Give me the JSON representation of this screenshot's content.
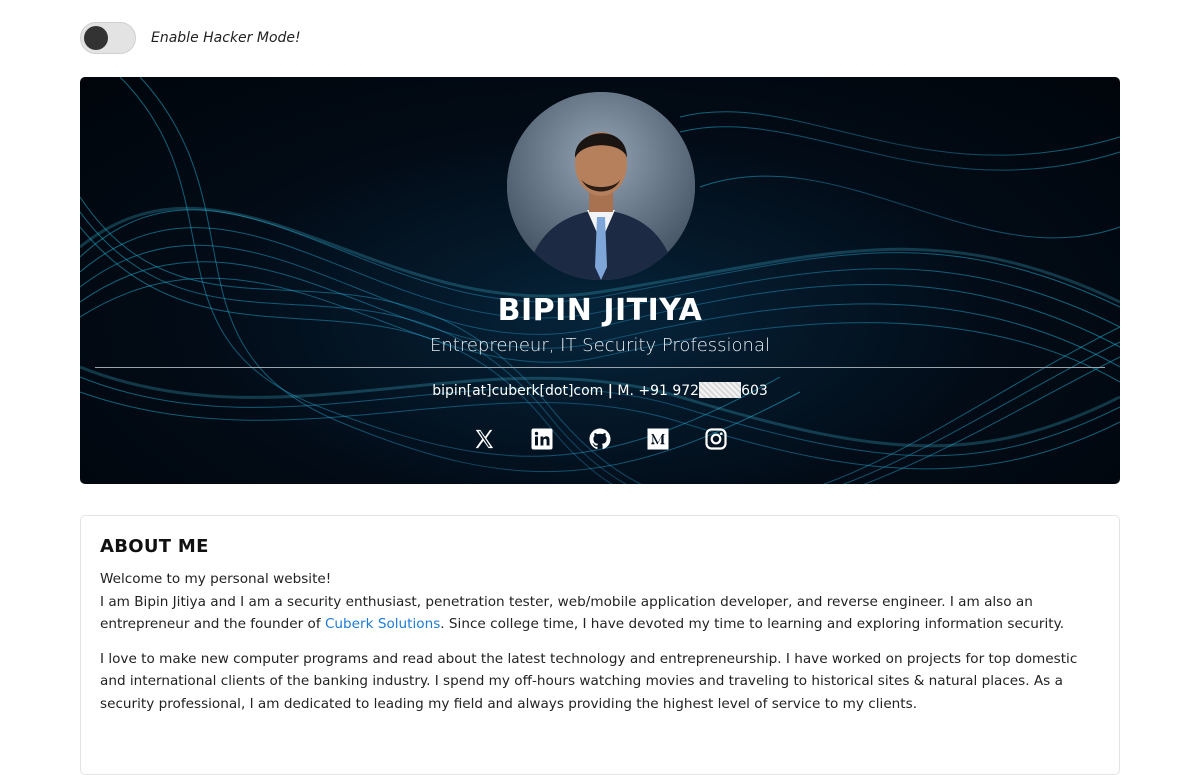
{
  "toggle": {
    "label": "Enable Hacker Mode!",
    "state": "off"
  },
  "profile": {
    "name": "BIPIN JITIYA",
    "subtitle": "Entrepreneur, IT Security Professional",
    "contact_email": "bipin[at]cuberk[dot]com",
    "contact_separator": "|",
    "contact_phone_prefix": "M. +91 972",
    "contact_phone_suffix": "603"
  },
  "socials": [
    {
      "name": "x",
      "icon": "x-icon"
    },
    {
      "name": "linkedin",
      "icon": "linkedin-icon"
    },
    {
      "name": "github",
      "icon": "github-icon"
    },
    {
      "name": "medium",
      "icon": "medium-icon"
    },
    {
      "name": "instagram",
      "icon": "instagram-icon"
    }
  ],
  "about": {
    "heading": "ABOUT ME",
    "intro": "Welcome to my personal website!",
    "p1_before_link": "I am Bipin Jitiya and I am a security enthusiast, penetration tester, web/mobile application developer, and reverse engineer. I am also an entrepreneur and the founder of ",
    "p1_link": "Cuberk Solutions",
    "p1_after_link": ". Since college time, I have devoted my time to learning and exploring information security.",
    "p2": "I love to make new computer programs and read about the latest technology and entrepreneurship. I have worked on projects for top domestic and international clients of the banking industry. I spend my off-hours watching movies and traveling to historical sites & natural places. As a security professional, I am dedicated to leading my field and always providing the highest level of service to my clients."
  },
  "colors": {
    "hero_bg": "#020b16",
    "wave": "#1ab3d6",
    "link": "#1d7bd6"
  }
}
